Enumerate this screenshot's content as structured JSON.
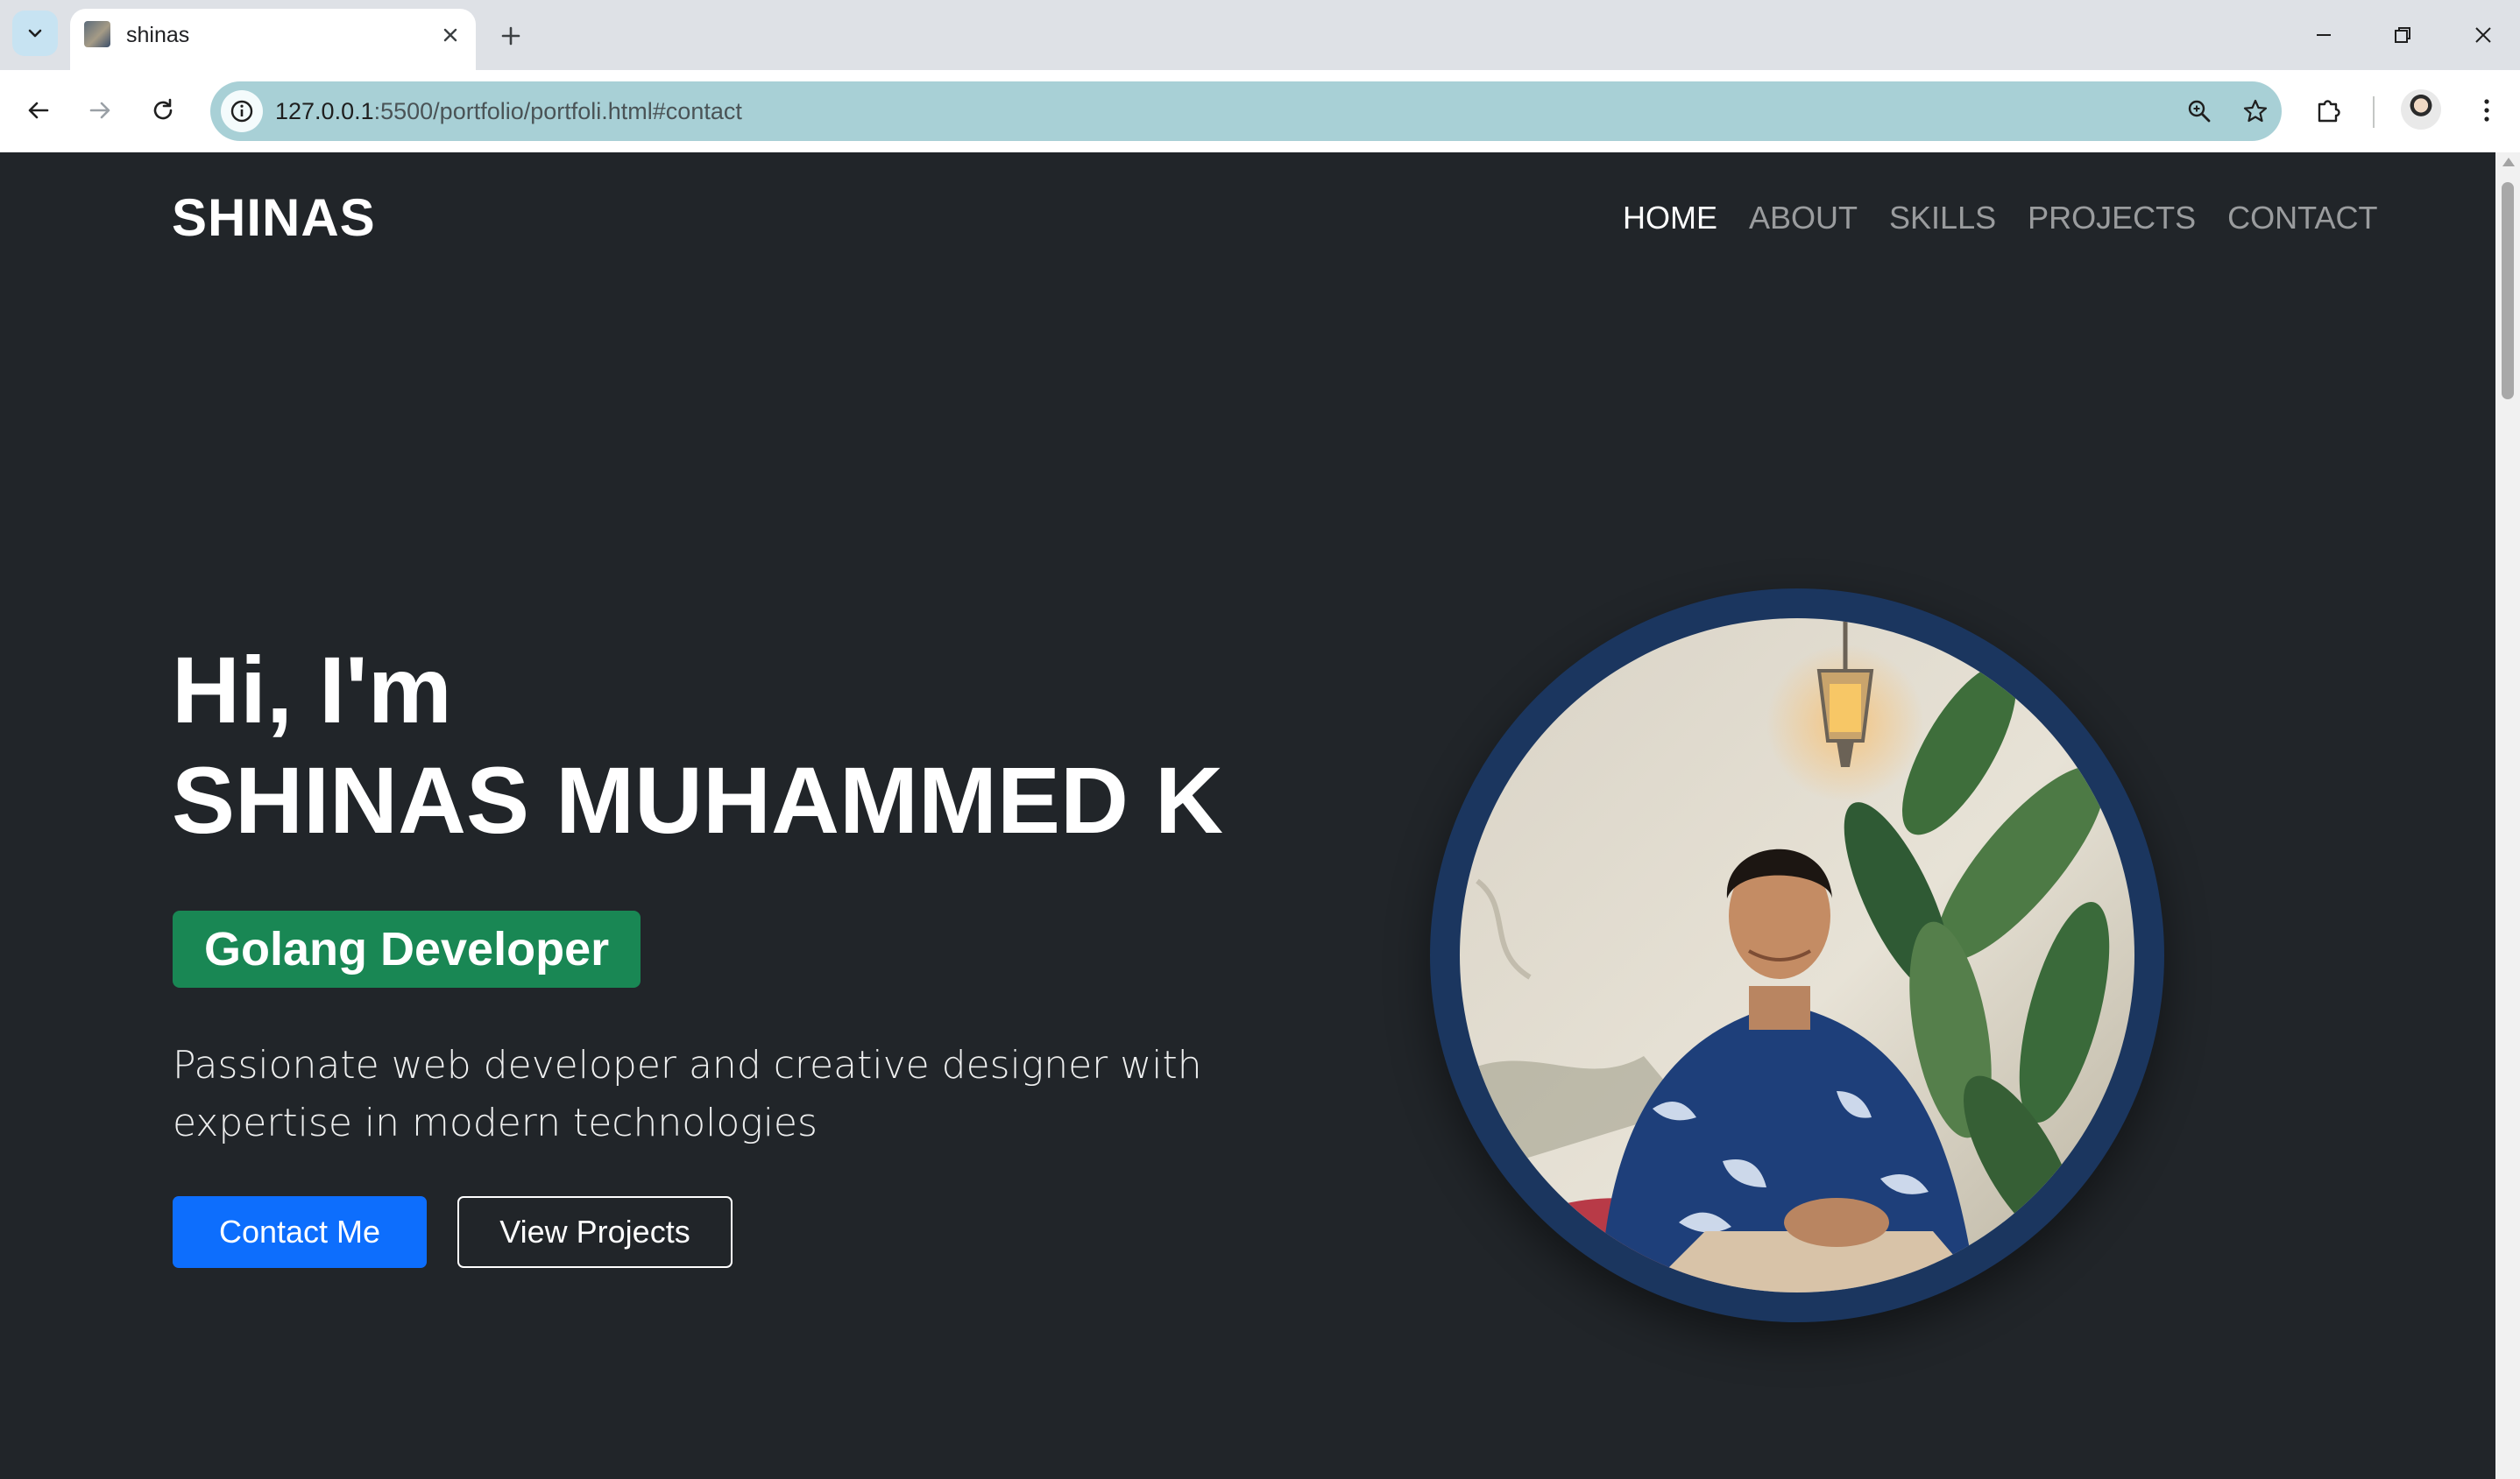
{
  "browser": {
    "tab_title": "shinas",
    "url_host": "127.0.0.1",
    "url_rest": ":5500/portfolio/portfoli.html#contact"
  },
  "site": {
    "brand": "SHINAS",
    "nav": [
      "HOME",
      "ABOUT",
      "SKILLS",
      "PROJECTS",
      "CONTACT"
    ],
    "active_nav": "HOME"
  },
  "hero": {
    "greeting": "Hi, I'm",
    "name": "SHINAS MUHAMMED K",
    "role": "Golang Developer",
    "tagline": "Passionate web developer and creative designer with expertise in modern technologies",
    "primary_button": "Contact Me",
    "secondary_button": "View Projects"
  },
  "colors": {
    "page_bg": "#212529",
    "badge": "#198754",
    "primary": "#0d6efd",
    "photo_ring": "#1b365f",
    "omnibox": "#a8d0d6"
  },
  "icons": {
    "tab_search": "chevron-down-icon",
    "tab_close": "close-icon",
    "new_tab": "plus-icon",
    "back": "arrow-left-icon",
    "forward": "arrow-right-icon",
    "reload": "reload-icon",
    "site_info": "info-icon",
    "zoom": "zoom-icon",
    "bookmark": "star-icon",
    "extensions": "puzzle-icon",
    "menu": "kebab-menu-icon"
  }
}
